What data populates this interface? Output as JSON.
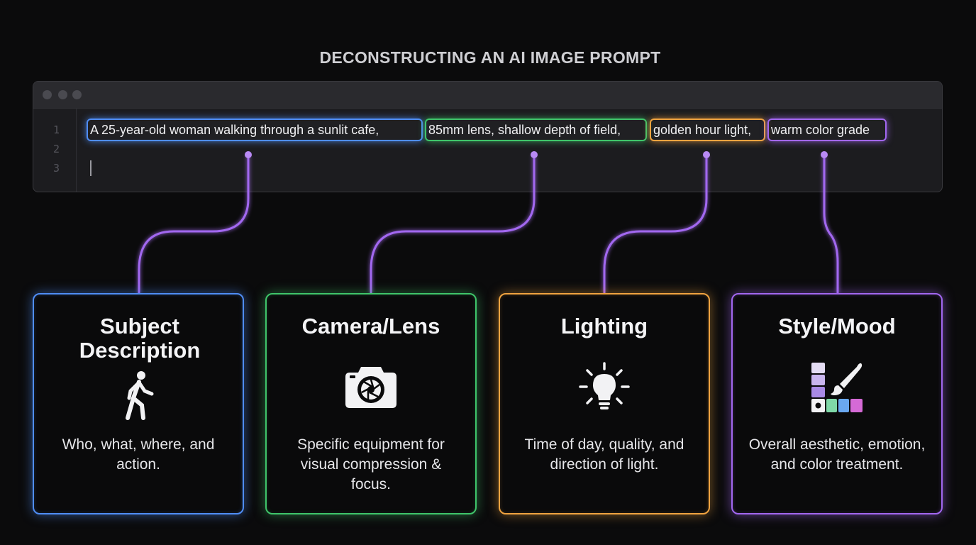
{
  "title": "DECONSTRUCTING AN AI IMAGE PROMPT",
  "editor": {
    "line_numbers": [
      "1",
      "2",
      "3"
    ],
    "segments": [
      {
        "text": "A 25-year-old woman walking through a sunlit cafe,",
        "color": "#4f8df5"
      },
      {
        "text": "85mm lens, shallow depth of field,",
        "color": "#3fc56a"
      },
      {
        "text": "golden hour light,",
        "color": "#f0a340"
      },
      {
        "text": "warm color grade",
        "color": "#a267f0"
      }
    ]
  },
  "connector_color": "#a267f0",
  "cards": [
    {
      "title": "Subject Description",
      "icon": "walking-person-icon",
      "description": "Who, what, where, and action.",
      "color": "#4f8df5"
    },
    {
      "title": "Camera/Lens",
      "icon": "camera-icon",
      "description": "Specific equipment for visual compression & focus.",
      "color": "#3fc56a"
    },
    {
      "title": "Lighting",
      "icon": "lightbulb-icon",
      "description": "Time of day, quality, and direction of light.",
      "color": "#f0a340"
    },
    {
      "title": "Style/Mood",
      "icon": "palette-brush-icon",
      "description": "Overall aesthetic, emotion, and color treatment.",
      "color": "#a267f0"
    }
  ]
}
